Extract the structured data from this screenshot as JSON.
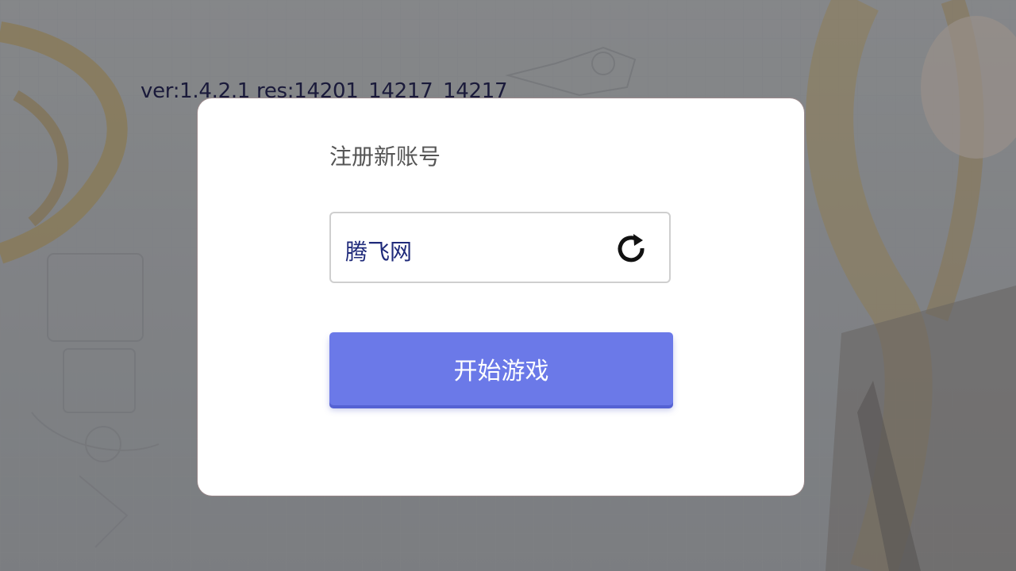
{
  "version_info": "ver:1.4.2.1 res:14201_14217_14217",
  "dialog": {
    "title": "注册新账号",
    "account_field": {
      "value": "腾飞网",
      "refresh_icon": "refresh-icon"
    },
    "start_button_label": "开始游戏"
  },
  "colors": {
    "button": "#6b79e8",
    "account_text": "#1f2a7a",
    "title_text": "#555555"
  }
}
